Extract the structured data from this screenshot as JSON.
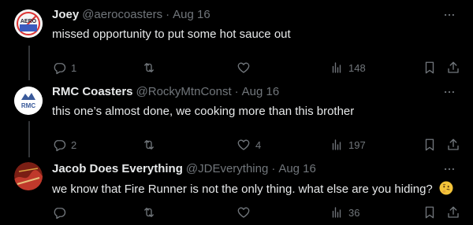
{
  "tweets": [
    {
      "display_name": "Joey",
      "handle": "@aerocoasters",
      "separator": "·",
      "time": "Aug 16",
      "text": "missed opportunity to put some hot sauce out",
      "avatar_text": "AERO",
      "replies": "1",
      "retweets": "",
      "likes": "",
      "views": "148"
    },
    {
      "display_name": "RMC Coasters",
      "handle": "@RockyMtnConst",
      "separator": "·",
      "time": "Aug 16",
      "text": "this one’s almost done, we cooking more than this brother",
      "avatar_text": "RMC",
      "replies": "2",
      "retweets": "",
      "likes": "4",
      "views": "197"
    },
    {
      "display_name": "Jacob Does Everything",
      "handle": "@JDEverything",
      "separator": "·",
      "time": "Aug 16",
      "text": "we know that Fire Runner is not the only thing. what else are you hiding?",
      "emoji": "thinking-face",
      "replies": "",
      "retweets": "",
      "likes": "",
      "views": "36"
    }
  ],
  "colors": {
    "background": "#000000",
    "primary_text": "#e7e9ea",
    "secondary_text": "#71767b",
    "thread_line": "#333639"
  }
}
